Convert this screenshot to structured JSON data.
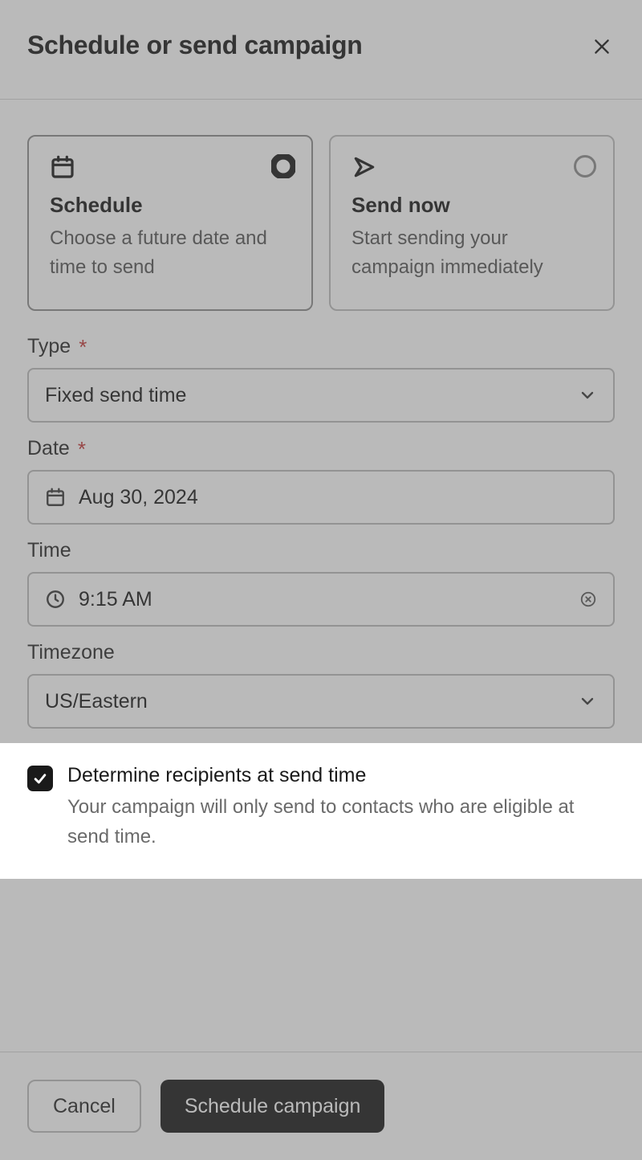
{
  "header": {
    "title": "Schedule or send campaign"
  },
  "options": {
    "schedule": {
      "title": "Schedule",
      "desc": "Choose a future date and time to send"
    },
    "send_now": {
      "title": "Send now",
      "desc": "Start sending your campaign immediately"
    }
  },
  "fields": {
    "type": {
      "label": "Type",
      "value": "Fixed send time"
    },
    "date": {
      "label": "Date",
      "value": "Aug 30, 2024"
    },
    "time": {
      "label": "Time",
      "value": "9:15 AM"
    },
    "timezone": {
      "label": "Timezone",
      "value": "US/Eastern"
    }
  },
  "checkbox": {
    "label": "Determine recipients at send time",
    "help": "Your campaign will only send to contacts who are eligible at send time."
  },
  "footer": {
    "cancel": "Cancel",
    "submit": "Schedule campaign"
  }
}
